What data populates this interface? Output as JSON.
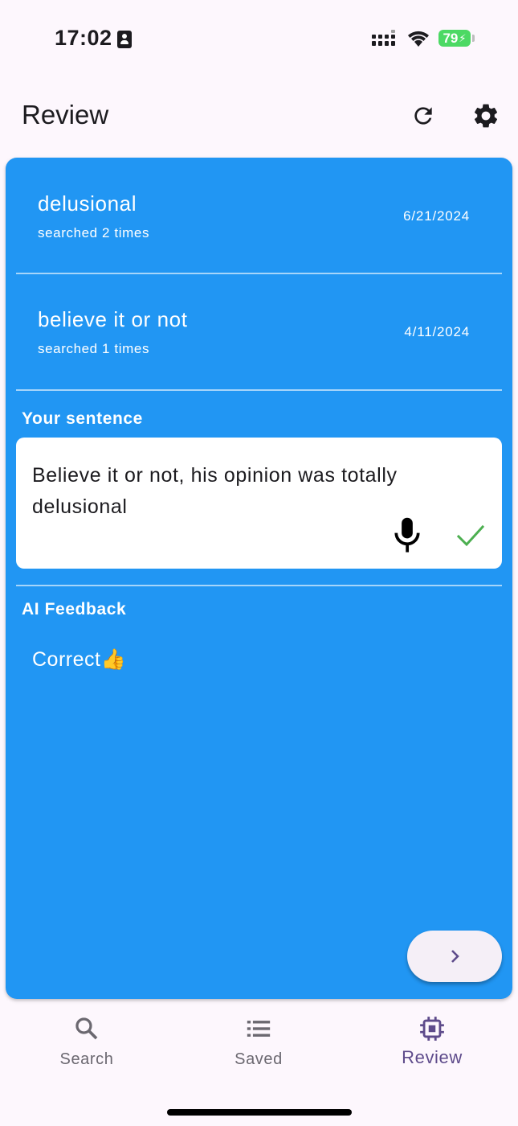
{
  "status_bar": {
    "time": "17:02",
    "battery": "79"
  },
  "header": {
    "title": "Review"
  },
  "word_list": [
    {
      "word": "delusional",
      "searched": "searched 2 times",
      "date": "6/21/2024"
    },
    {
      "word": "believe it or not",
      "searched": "searched 1 times",
      "date": "4/11/2024"
    }
  ],
  "sentence_section": {
    "label": "Your sentence",
    "text": "Believe it or not, his opinion was totally delusional"
  },
  "feedback_section": {
    "label": "AI Feedback",
    "text": "Correct👍"
  },
  "bottom_nav": {
    "items": [
      {
        "label": "Search",
        "icon": "search-icon"
      },
      {
        "label": "Saved",
        "icon": "list-icon"
      },
      {
        "label": "Review",
        "icon": "chip-icon",
        "active": true
      }
    ]
  },
  "colors": {
    "card": "#2196F3",
    "active_nav": "#5E4B8B",
    "check": "#4CAF50"
  }
}
